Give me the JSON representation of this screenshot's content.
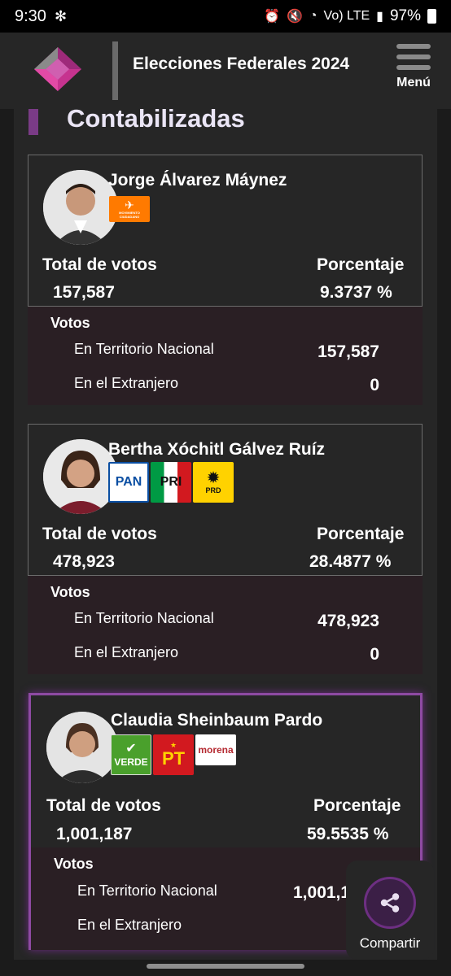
{
  "status_bar": {
    "time": "9:30",
    "battery": "97%",
    "network": "Vo) LTE"
  },
  "header": {
    "title": "Elecciones Federales 2024",
    "menu_label": "Menú"
  },
  "section": {
    "title": "Contabilizadas"
  },
  "labels": {
    "total_votos": "Total de votos",
    "porcentaje": "Porcentaje",
    "votos": "Votos",
    "territorio": "En Territorio Nacional",
    "extranjero": "En el Extranjero"
  },
  "candidates": [
    {
      "name": "Jorge Álvarez Máynez",
      "total_votes": "157,587",
      "percentage": "9.3737 %",
      "territorio_nacional": "157,587",
      "extranjero": "0",
      "parties": [
        {
          "name": "MOVIMIENTO CIUDADANO",
          "color": "#ff7a00"
        }
      ]
    },
    {
      "name": "Bertha Xóchitl Gálvez Ruíz",
      "total_votes": "478,923",
      "percentage": "28.4877 %",
      "territorio_nacional": "478,923",
      "extranjero": "0",
      "parties": [
        {
          "name": "PAN",
          "color": "#0a4ea2"
        },
        {
          "name": "PRI",
          "color": "#009a44"
        },
        {
          "name": "PRD",
          "color": "#ffd200"
        }
      ]
    },
    {
      "name": "Claudia Sheinbaum Pardo",
      "total_votes": "1,001,187",
      "percentage": "59.5535 %",
      "territorio_nacional": "1,001,1",
      "extranjero": "",
      "parties": [
        {
          "name": "VERDE",
          "color": "#4aa02c"
        },
        {
          "name": "PT",
          "color": "#d2191f"
        },
        {
          "name": "morena",
          "color": "#b52a31"
        }
      ]
    }
  ],
  "share": {
    "label": "Compartir"
  },
  "colors": {
    "accent": "#7a3b86",
    "panel": "#262626",
    "background": "#1b1b1b"
  }
}
